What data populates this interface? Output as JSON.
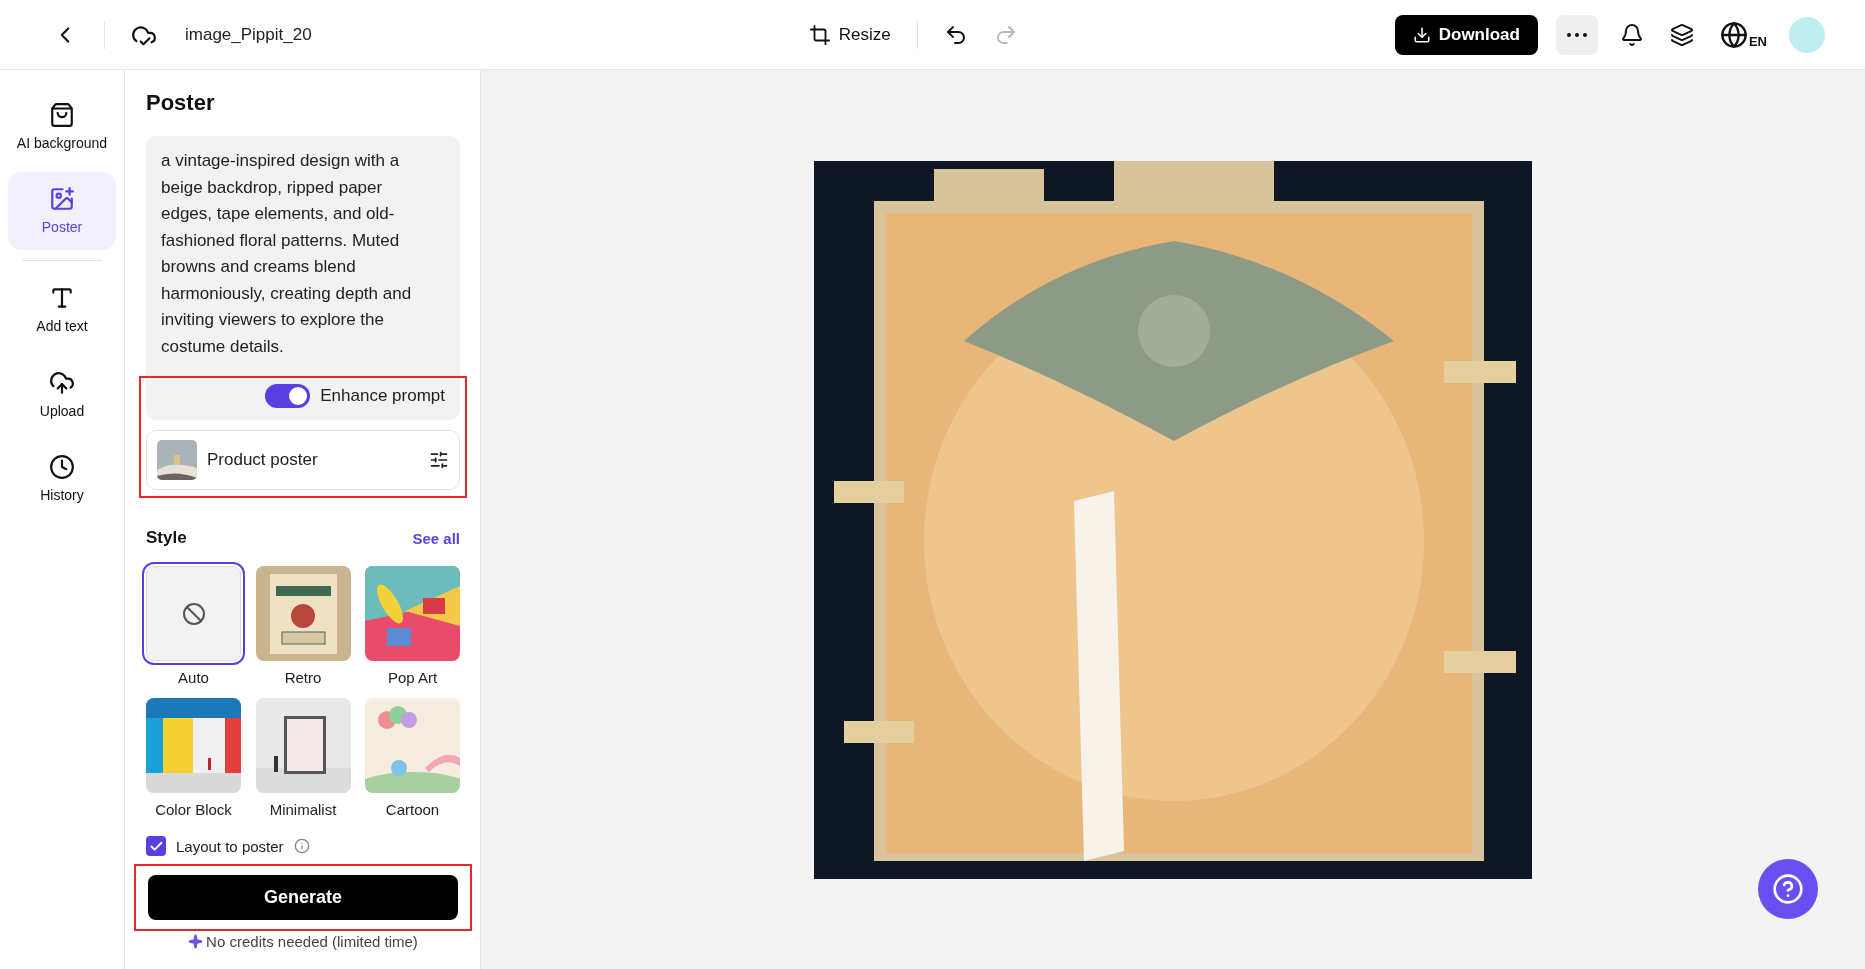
{
  "header": {
    "title": "image_Pippit_20",
    "resize": "Resize",
    "undo": {
      "disabled": false
    },
    "redo": {
      "disabled": true
    },
    "download": "Download",
    "language": "EN"
  },
  "sidebar": {
    "items": [
      {
        "label": "AI background",
        "selected": false
      },
      {
        "label": "Poster",
        "selected": true
      },
      {
        "label": "Add text",
        "selected": false
      },
      {
        "label": "Upload",
        "selected": false
      },
      {
        "label": "History",
        "selected": false
      }
    ]
  },
  "panel": {
    "title": "Poster",
    "prompt": "a vintage-inspired design with a beige backdrop, ripped paper edges, tape elements, and old-fashioned floral patterns. Muted browns and creams blend harmoniously, creating depth and inviting viewers to explore the costume details.",
    "enhance_prompt": {
      "label": "Enhance prompt",
      "on": true
    },
    "template": {
      "label": "Product poster"
    },
    "options_highlighted": true,
    "style_heading": "Style",
    "see_all": "See all",
    "styles": [
      {
        "label": "Auto",
        "kind": "none",
        "selected": true
      },
      {
        "label": "Retro",
        "kind": "picture",
        "selected": false
      },
      {
        "label": "Pop Art",
        "kind": "picture",
        "selected": false
      },
      {
        "label": "Color Block",
        "kind": "picture",
        "selected": false
      },
      {
        "label": "Minimalist",
        "kind": "picture",
        "selected": false
      },
      {
        "label": "Cartoon",
        "kind": "picture",
        "selected": false
      }
    ],
    "layout_to_poster": {
      "label": "Layout to poster",
      "checked": true
    },
    "generate": "Generate",
    "generate_highlighted": true,
    "note": "No credits needed (limited time)"
  }
}
